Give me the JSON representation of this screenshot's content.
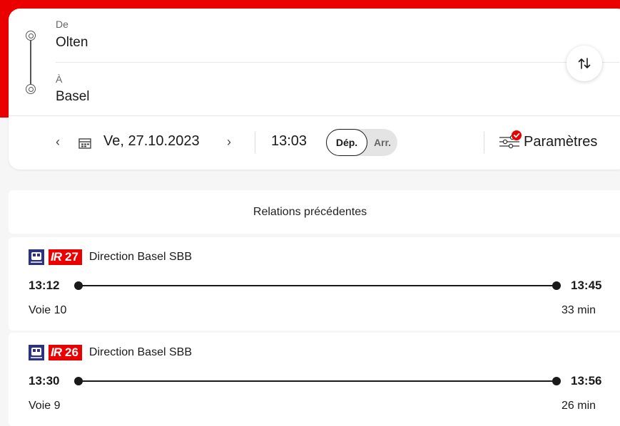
{
  "colors": {
    "brand_red": "#eb0000",
    "background": "#f6f6f6"
  },
  "search": {
    "from_label": "De",
    "from_value": "Olten",
    "to_label": "À",
    "to_value": "Basel",
    "swap_icon": "swap-vertical-icon"
  },
  "datetime": {
    "prev_label": "‹",
    "next_label": "›",
    "date": "Ve, 27.10.2023",
    "time": "13:03",
    "dep_label": "Dép.",
    "arr_label": "Arr.",
    "selected": "Dép.",
    "settings_label": "Paramètres",
    "settings_badge_icon": "check-badge-icon"
  },
  "results": {
    "previous_label": "Relations précédentes",
    "trips": [
      {
        "line_prefix": "IR",
        "line_number": "27",
        "direction": "Direction Basel SBB",
        "departure": "13:12",
        "arrival": "13:45",
        "platform": "Voie 10",
        "duration": "33 min"
      },
      {
        "line_prefix": "IR",
        "line_number": "26",
        "direction": "Direction Basel SBB",
        "departure": "13:30",
        "arrival": "13:56",
        "platform": "Voie 9",
        "duration": "26 min"
      }
    ]
  }
}
